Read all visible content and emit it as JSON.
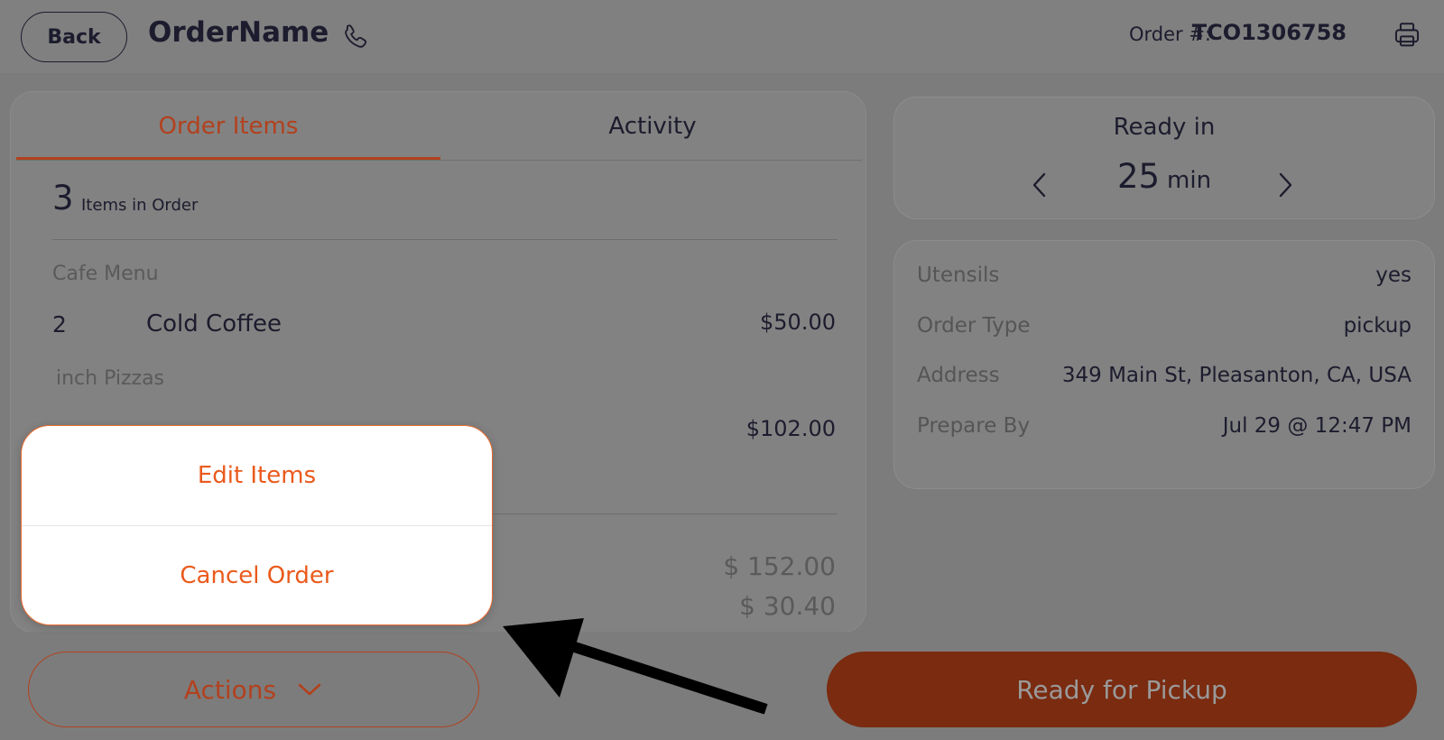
{
  "header": {
    "back_label": "Back",
    "order_name": "OrderName",
    "order_number_label": "Order #:",
    "order_number_value": "TCO1306758",
    "phone_icon": "phone-icon",
    "print_icon": "printer-icon"
  },
  "tabs": [
    {
      "label": "Order Items",
      "active": true
    },
    {
      "label": "Activity",
      "active": false
    }
  ],
  "order_summary": {
    "count": "3",
    "count_label": "Items in Order"
  },
  "menu_sections": [
    {
      "category": "Cafe Menu",
      "items": [
        {
          "qty": "2",
          "name": "Cold Coffee",
          "price": "$50.00"
        }
      ]
    },
    {
      "category": "inch Pizzas",
      "items": [
        {
          "qty": "",
          "name": "",
          "price": "$102.00"
        }
      ]
    }
  ],
  "totals": {
    "subtotal": "$ 152.00",
    "partial_total": "$ 30.40"
  },
  "ready": {
    "title": "Ready in",
    "value": "25",
    "unit": "min"
  },
  "details": [
    {
      "label": "Utensils",
      "value": "yes"
    },
    {
      "label": "Order Type",
      "value": "pickup"
    },
    {
      "label": "Address",
      "value": "349 Main St, Pleasanton, CA, USA"
    },
    {
      "label": "Prepare By",
      "value": "Jul 29 @ 12:47 PM"
    }
  ],
  "footer": {
    "actions_label": "Actions",
    "ready_label": "Ready for Pickup"
  },
  "popup": {
    "items": [
      {
        "label": "Edit Items"
      },
      {
        "label": "Cancel Order"
      }
    ]
  },
  "colors": {
    "accent": "#ea5a1c",
    "accent_dim": "#b2411e",
    "primary_button": "#7a2b10",
    "text_dark": "#1c1c2e",
    "overlay_bg": "#7c7c7c"
  }
}
